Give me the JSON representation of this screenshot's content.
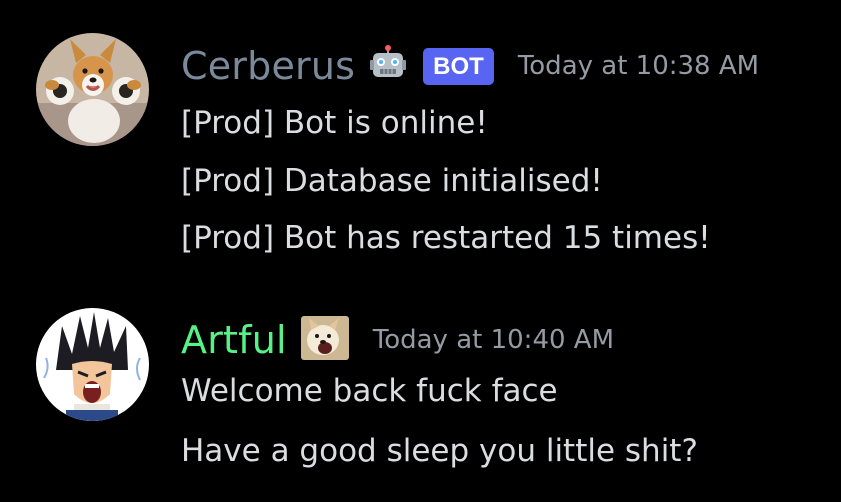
{
  "messages": [
    {
      "author": "Cerberus",
      "author_color": "#7b8a9b",
      "avatar_icon": "corgi-avatar",
      "role_icon": "robot-icon",
      "tag": "BOT",
      "timestamp": "Today at 10:38 AM",
      "lines": [
        "[Prod] Bot is online!",
        "[Prod] Database initialised!",
        "[Prod] Bot has restarted 15 times!"
      ]
    },
    {
      "author": "Artful",
      "author_color": "#57f287",
      "avatar_icon": "anime-character-avatar",
      "role_icon": "dog-emoji-icon",
      "timestamp": "Today at 10:40 AM",
      "lines": [
        "Welcome back fuck face",
        "Have a good sleep you little shit?"
      ]
    }
  ],
  "colors": {
    "background": "#000000",
    "bot_tag": "#5865f2",
    "timestamp": "#949ba4",
    "message_text": "#dbdee1"
  }
}
